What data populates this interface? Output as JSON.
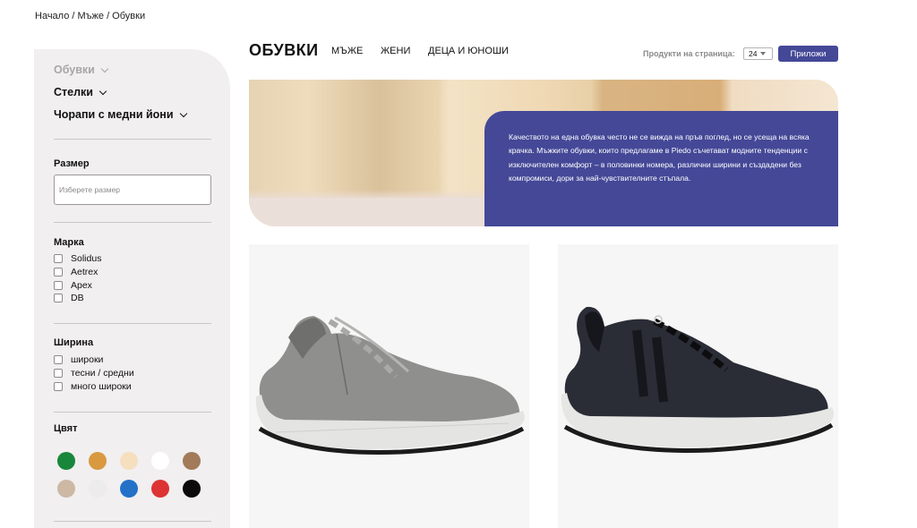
{
  "breadcrumb": {
    "text": "Начало / Мъже / Обувки"
  },
  "sidebar": {
    "categories": [
      {
        "label": "Обувки",
        "muted": true
      },
      {
        "label": "Стелки",
        "muted": false
      },
      {
        "label": "Чорапи с медни йони",
        "muted": false
      }
    ],
    "size": {
      "title": "Размер",
      "placeholder": "Изберете размер"
    },
    "brand": {
      "title": "Марка",
      "options": [
        "Solidus",
        "Aetrex",
        "Apex",
        "DB"
      ]
    },
    "width": {
      "title": "Ширина",
      "options": [
        "широки",
        "тесни / средни",
        "много широки"
      ]
    },
    "color": {
      "title": "Цвят",
      "swatches": [
        "#18863b",
        "#d9993f",
        "#f6dfbf",
        "#ffffff",
        "#a27b59",
        "#cdb8a4",
        "#ececec",
        "#2471c8",
        "#dd3333",
        "#0b0b0b"
      ]
    }
  },
  "header": {
    "title": "ОБУВКИ",
    "nav": [
      "МЪЖЕ",
      "ЖЕНИ",
      "ДЕЦА И ЮНОШИ"
    ],
    "per_page_label": "Продукти на страница:",
    "per_page_value": "24",
    "apply_label": "Приложи"
  },
  "hero": {
    "text": "Качеството на една обувка често не се вижда на пръв поглед, но се усеща на всяка крачка.  Мъжките обувки, които предлагаме в Piedo съчетават модните тенденции с изключителен комфорт – в половинки номера, различни ширини и създадени без компромиси, дори за най-чувствителните стъпала."
  },
  "products": [
    {
      "name": "grey-sneaker",
      "upper": "#8f8f8d",
      "upper_dark": "#6f6f6d",
      "laces": "#a9a9a7"
    },
    {
      "name": "black-sneaker",
      "upper": "#2a2d36",
      "upper_dark": "#15171d",
      "laces": "#0d0d0f"
    }
  ],
  "colors": {
    "accent": "#444897",
    "sidebar_bg": "#f1eff0"
  }
}
